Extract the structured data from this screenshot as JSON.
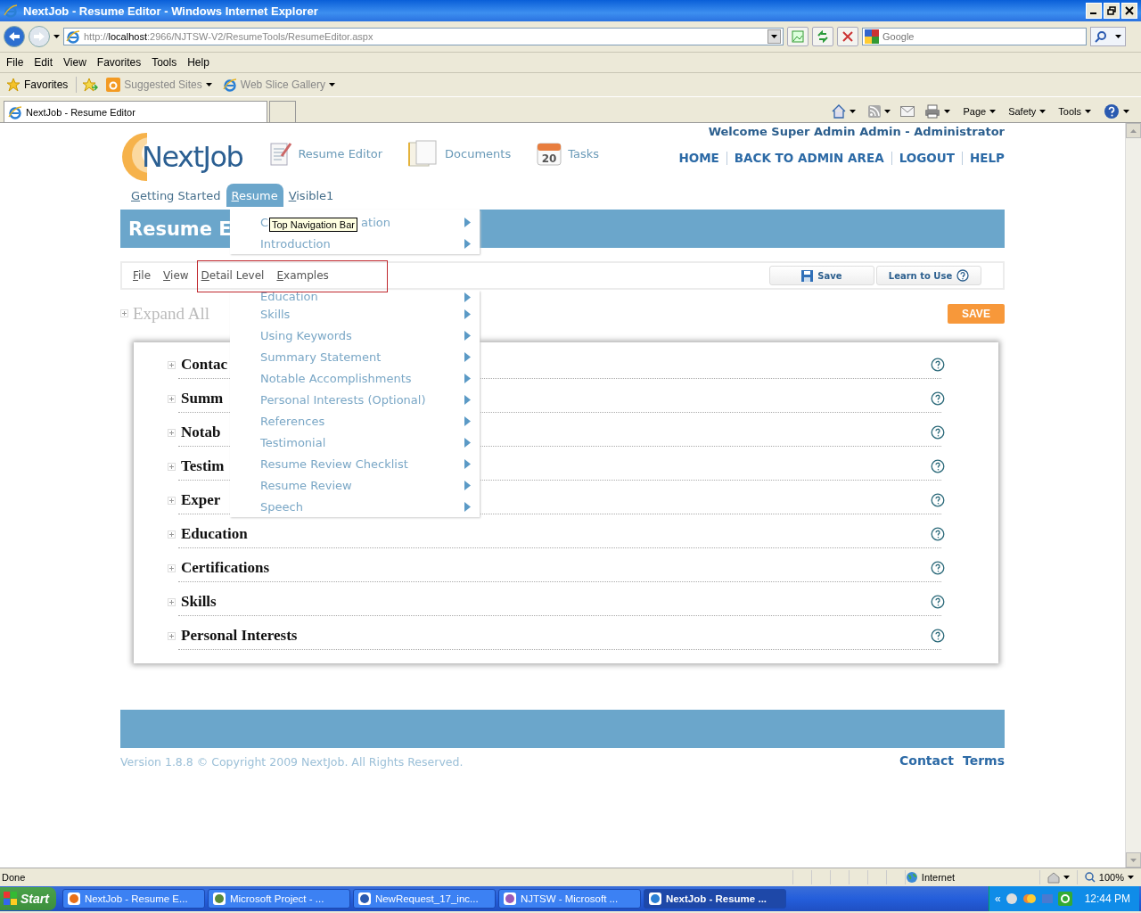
{
  "window": {
    "title": "NextJob - Resume Editor - Windows Internet Explorer"
  },
  "address_bar": {
    "url_prefix": "http://",
    "url_host": "localhost",
    "url_rest": ":2966/NJTSW-V2/ResumeTools/ResumeEditor.aspx"
  },
  "search": {
    "placeholder": "Google"
  },
  "menu_bar": [
    "File",
    "Edit",
    "View",
    "Favorites",
    "Tools",
    "Help"
  ],
  "favorites_bar": {
    "label": "Favorites",
    "links": [
      "Suggested Sites",
      "Web Slice Gallery"
    ]
  },
  "tab": {
    "title": "NextJob - Resume Editor"
  },
  "command_bar": [
    "Page",
    "Safety",
    "Tools"
  ],
  "page": {
    "logo": "NextJob",
    "welcome": "Welcome Super Admin Admin - Administrator",
    "top_links": [
      "HOME",
      "BACK TO ADMIN AREA",
      "LOGOUT",
      "HELP"
    ],
    "modules": [
      {
        "label": "Resume Editor",
        "kind": "editor"
      },
      {
        "label": "Documents",
        "kind": "documents"
      },
      {
        "label": "Tasks",
        "kind": "calendar",
        "day": "20"
      }
    ],
    "nav_tabs": [
      {
        "label": "Getting Started",
        "selected": false
      },
      {
        "label": "Resume",
        "selected": true
      },
      {
        "label": "Visible1",
        "selected": false
      }
    ],
    "banner_title": "Resume E",
    "toolbar_menu": [
      "File",
      "View",
      "Detail Level",
      "Examples"
    ],
    "toolbar_buttons": [
      {
        "label": "Save",
        "kind": "save"
      },
      {
        "label": "Learn to Use",
        "kind": "help"
      }
    ],
    "expand_all": "Expand All",
    "save_button": "SAVE",
    "sections": [
      {
        "title": "Contac"
      },
      {
        "title": "Summ"
      },
      {
        "title": "Notab"
      },
      {
        "title": "Testim"
      },
      {
        "title": "Exper"
      },
      {
        "title": "Education"
      },
      {
        "title": "Certifications"
      },
      {
        "title": "Skills"
      },
      {
        "title": "Personal Interests"
      }
    ],
    "dropdown": {
      "first_item": {
        "label_start": "C",
        "label_end": "ation"
      },
      "top_items": [
        "Introduction"
      ],
      "items": [
        "Education",
        "Skills",
        "Using Keywords",
        "Summary Statement",
        "Notable Accomplishments",
        "Personal Interests (Optional)",
        "References",
        "Testimonial",
        "Resume Review Checklist",
        "Resume Review",
        "Speech"
      ]
    },
    "tooltip": "Top Navigation Bar",
    "footer": {
      "version": "Version 1.8.8 © Copyright 2009 NextJob. All Rights Reserved.",
      "links": [
        "Contact",
        "Terms"
      ]
    }
  },
  "status_bar": {
    "text": "Done",
    "zone": "Internet",
    "zoom": "100%"
  },
  "taskbar": {
    "start": "Start",
    "tasks": [
      {
        "label": "NextJob - Resume E...",
        "kind": "firefox",
        "selected": false
      },
      {
        "label": "Microsoft Project - ...",
        "kind": "project",
        "selected": false
      },
      {
        "label": "NewRequest_17_inc...",
        "kind": "word",
        "selected": false
      },
      {
        "label": "NJTSW - Microsoft ...",
        "kind": "studio",
        "selected": false
      },
      {
        "label": "NextJob - Resume ...",
        "kind": "ie",
        "selected": true
      }
    ],
    "tray_toggle": "«",
    "clock": "12:44 PM"
  }
}
